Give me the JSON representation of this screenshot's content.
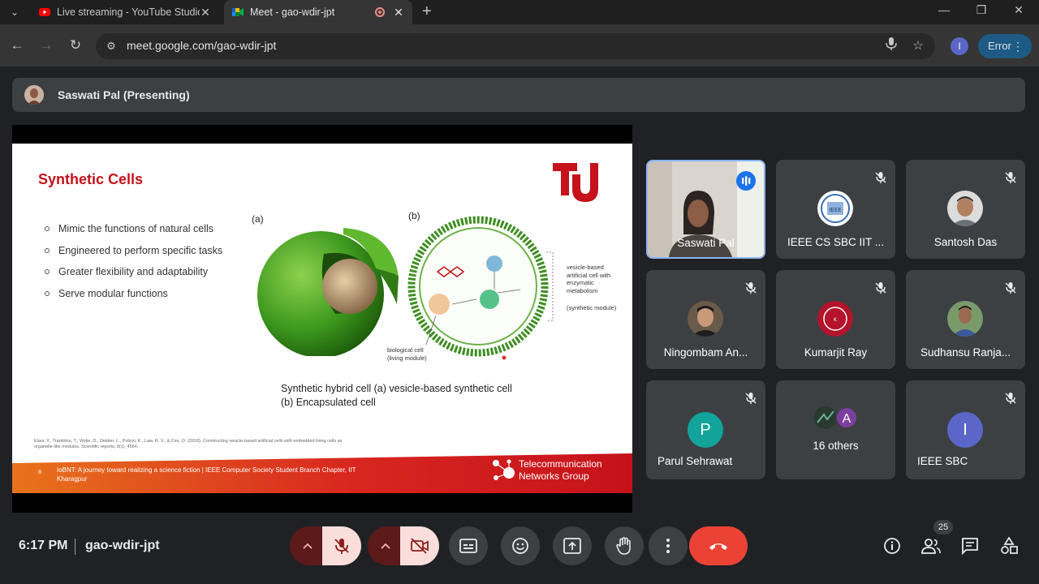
{
  "browser": {
    "tabs": [
      {
        "title": "Live streaming - YouTube Studio",
        "active": false
      },
      {
        "title": "Meet - gao-wdir-jpt",
        "active": true
      }
    ],
    "url": "meet.google.com/gao-wdir-jpt",
    "profile_initial": "I",
    "error_label": "Error"
  },
  "meet": {
    "presenter_label": "Saswati Pal (Presenting)",
    "time": "6:17 PM",
    "meeting_code": "gao-wdir-jpt",
    "participant_count": "25"
  },
  "slide": {
    "title": "Synthetic Cells",
    "bullets": [
      "Mimic the functions of natural cells",
      "Engineered to perform specific tasks",
      "Greater flexibility and adaptability",
      "Serve modular functions"
    ],
    "fig_a_label": "(a)",
    "fig_b_label": "(b)",
    "fig_labels": {
      "vesicle": "vesicle-based artificial cell with enzymatic metabolism",
      "synthetic_module": "(synthetic module)",
      "bio_cell": "biological cell (living module)"
    },
    "caption_line1": "Synthetic hybrid cell (a) vesicle-based synthetic cell",
    "caption_line2": "(b) Encapsulated cell",
    "footnote": "Elani, Y., Trantidou, T., Wylie, D., Dekker, L., Polizzi, K., Law, R. V., & Ces, O. (2018). Constructing vesicle-based artificial cells with embedded living cells as organelle-like modules. Scientific reports, 8(1), 4564.",
    "footer_page": "8",
    "footer_text": "IoBNT: A journey toward realizing a science fiction | IEEE Computer Society Student Branch Chapter, IIT Kharagpur",
    "logo_line1": "Telecommunication",
    "logo_line2": "Networks Group"
  },
  "participants": [
    {
      "name": "Saswati Pal",
      "kind": "video",
      "speaking": true
    },
    {
      "name": "IEEE CS SBC IIT ...",
      "kind": "avatar",
      "muted": true
    },
    {
      "name": "Santosh Das",
      "kind": "avatar",
      "muted": true
    },
    {
      "name": "Ningombam An...",
      "kind": "avatar",
      "muted": true
    },
    {
      "name": "Kumarjit Ray",
      "kind": "avatar",
      "muted": true
    },
    {
      "name": "Sudhansu Ranja...",
      "kind": "avatar",
      "muted": true
    },
    {
      "name": "Parul Sehrawat",
      "kind": "letter",
      "letter": "P",
      "color": "#12a39a",
      "muted": true
    },
    {
      "name": "16 others",
      "kind": "group",
      "letter": "A",
      "color": "#7b3f9e"
    },
    {
      "name": "IEEE SBC",
      "kind": "letter",
      "letter": "I",
      "color": "#5b67c8",
      "muted": true
    }
  ],
  "colors": {
    "slide_title": "#c5121b",
    "hangup": "#ea4335",
    "active_border": "#8ab4f8"
  }
}
